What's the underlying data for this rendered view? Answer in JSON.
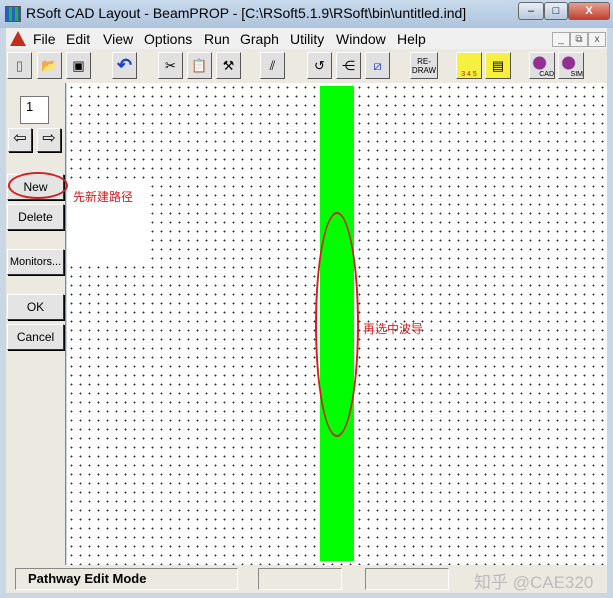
{
  "window": {
    "title": "RSoft CAD Layout - BeamPROP - [C:\\RSoft5.1.9\\RSoft\\bin\\untitled.ind]",
    "minimize": "–",
    "maximize": "□",
    "close": "X"
  },
  "menu": [
    "File",
    "Edit",
    "View",
    "Options",
    "Run",
    "Graph",
    "Utility",
    "Window",
    "Help"
  ],
  "mdi": {
    "minimize": "_",
    "restore": "⧉",
    "close": "x"
  },
  "toolbar": {
    "redraw": "RE-\nDRAW",
    "cad": "CAD",
    "sim": "SIM",
    "scale": "3 4 5"
  },
  "left": {
    "segment_number": "1",
    "new": "New",
    "delete": "Delete",
    "monitors": "Monitors...",
    "ok": "OK",
    "cancel": "Cancel"
  },
  "annotations": {
    "first": "先新建路径",
    "second": "再选中波导"
  },
  "status": {
    "mode": "Pathway Edit Mode",
    "watermark": "知乎 @CAE320"
  },
  "colors": {
    "waveguide": "#00ff00",
    "annotation": "#d02020"
  }
}
